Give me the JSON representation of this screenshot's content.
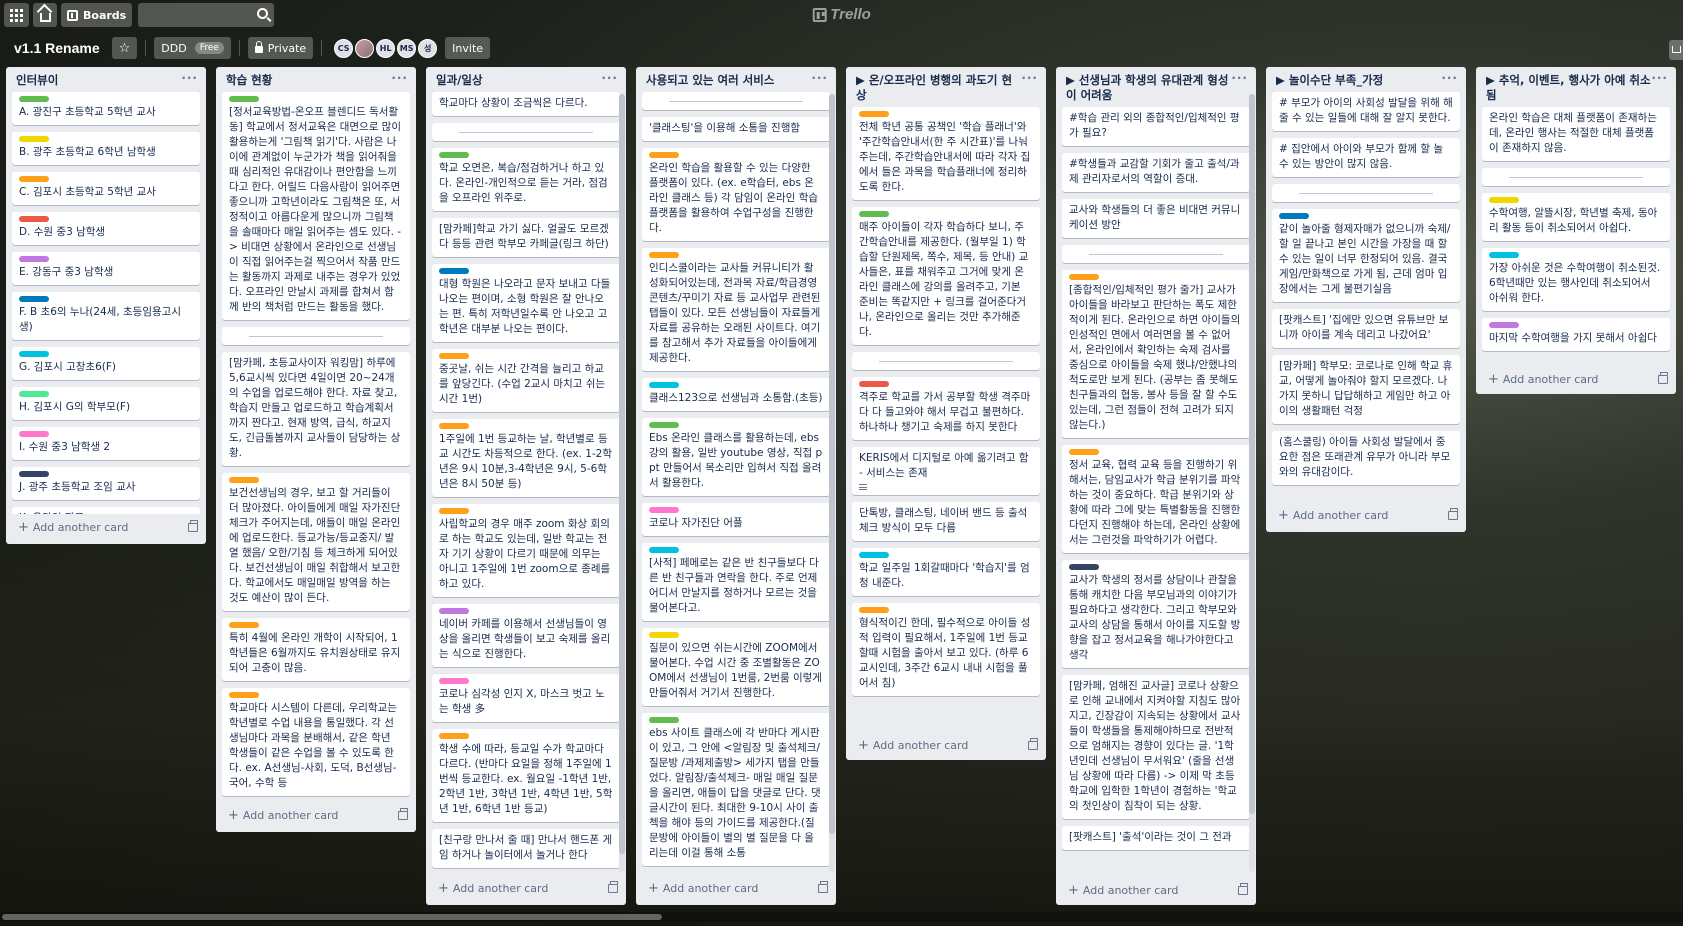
{
  "topbar": {
    "boards_label": "Boards",
    "logo": "Trello",
    "search_value": ""
  },
  "board": {
    "title": "v1.1 Rename",
    "team": "DDD",
    "plan": "Free",
    "visibility": "Private",
    "invite_label": "Invite",
    "members": [
      "CS",
      "",
      "HL",
      "MS",
      "성"
    ]
  },
  "add_card_label": "Add another card",
  "lists": [
    {
      "title": "인터뷰이",
      "cards": [
        {
          "label": "green",
          "text": "A. 광진구 초등학교 5학년 교사"
        },
        {
          "label": "yellow",
          "text": "B. 광주 초등학교 6학년 남학생"
        },
        {
          "label": "orange",
          "text": "C. 김포시 초등학교 5학년 교사"
        },
        {
          "label": "red",
          "text": "D. 수원 중3 남학생"
        },
        {
          "label": "purple",
          "text": "E. 강동구 중3 남학생"
        },
        {
          "label": "blue",
          "text": "F. B 초6의 누나(24세, 초등임용고시생)"
        },
        {
          "label": "sky",
          "text": "G. 김포시 고창초6(F)"
        },
        {
          "label": "lime",
          "text": "H. 김포시 G의 학부모(F)"
        },
        {
          "label": "pink",
          "text": "I. 수원 중3 남학생 2"
        },
        {
          "label": "black",
          "text": "J. 광주 초등학교 조임 교사"
        },
        {
          "label": "",
          "text": "K. 온라인 자료"
        }
      ]
    },
    {
      "title": "학습 현황",
      "cards": [
        {
          "label": "green",
          "text": "[정서교육방법-온오프 블렌디드 독서활동] 학교에서 정서교육은 대면으로 많이 활용하는게 '그림책 읽기'다. 사람은 나이에 관계없이 누군가가 책을 읽어줘을 때 심리적인 유대감이나 편안함을 느끼다고 한다. 어릴드 다음사람이 읽어주면 좋으니까 고학년이라도 그림책은 또, 서정적이고 아름다운게 많으니까 그림책을 솔때마다 매일 읽어주는 셈도 있다. -> 비대면 상황에서 온라인으로 선생님이 직접 읽어주는걸 찍으어서 작품 만드는 활동까지 과제로 내주는 경우가 있었다. 오프라인 만날시 과제를 합쳐서 함께 반의 책처럼 만드는 활동을 했다."
        },
        {
          "label": "",
          "divider": true,
          "text": ""
        },
        {
          "label": "",
          "text": "[맘카페, 초등교사이자 워킹맘] 하루에 5,6교시씩 있다면 4일이면 20~24개의 수업을 업로드해야 한다. 자료 찾고, 학습지 만들고 업로드하고 학습계획서까지 짠다고. 현재 방역, 급식, 하교지도, 긴급돌봄까지 교사들이 담당하는 상황."
        },
        {
          "label": "orange",
          "text": "보건선생님의 경우, 보고 할 거리들이 더 많아졌다. 아이들에게 매일 자가진단체크가 주어지는데, 애들이 매일 온라인에 업로드한다. 등교가능/등교중지/ 발열 했음/ 오한/기침 등 체크하게 되어있다. 보건선생님이 매일 취합해서 보고한다. 학교에서도 매일매일 방역을 하는 것도 예산이 많이 든다."
        },
        {
          "label": "orange",
          "text": "특히 4월에 온라인 개학이 시작되어, 1학년들은 6월까지도 유치원상태로 유지되어 고충이 많음."
        },
        {
          "label": "orange",
          "text": "학교마다 시스템이 다른데, 우리학교는 학년별로 수업 내용을 통일했다. 각 선생님마다 과목을 분배해서, 같은 학년 학생들이 같은 수업을 볼 수 있도록 한다. ex. A선생님-사회, 도덕, B선생님-국어, 수학 등"
        }
      ]
    },
    {
      "title": "일과/일상",
      "cards": [
        {
          "label": "",
          "text": "학교마다 상황이 조금씩은 다르다."
        },
        {
          "label": "",
          "divider": true,
          "text": ""
        },
        {
          "label": "green",
          "text": "학교 오면은, 복습/점검하거나 하고 있다. 온라인-개인적으로 듣는 거라, 점검을 오프라인 위주로."
        },
        {
          "label": "",
          "text": "[맘카페]학교 가기 싫다. 얼굴도 모르겠다 등등 관련 학부모 카페글(링크 하단)"
        },
        {
          "label": "blue",
          "text": "대형 학원은 나오라고 문자 보내고 다들 나오는 편이며, 소형 학원은 잘 안나오는 편. 특히 저학년일수록 안 나오고 고학년은 대부분 나오는 편이다."
        },
        {
          "label": "orange",
          "text": "중곳날, 쉬는 시간 간격을 늘리고 하교를 앞당긴다. (수업 2교시 마치고 쉬는시간 1번)"
        },
        {
          "label": "orange",
          "text": "1주일에 1번 등교하는 날, 학년별로 등교 시간도 차등적으로 한다. (ex. 1-2학년은 9시 10분,3-4학년은 9시, 5-6학년은 8시 50분 등)"
        },
        {
          "label": "orange",
          "text": "사립학교의 경우 매주 zoom 화상 회의로 하는 학교도 있는데, 일반 학교는 전자 기기 상황이 다르기 때문에 의무는 아니고 1주일에 1번 zoom으로 종례를 하고 있다."
        },
        {
          "label": "purple",
          "text": "네이버 카페를 이용해서 선생님들이 영상을 올리면 학생들이 보고 숙제를 올리는 식으로 진행한다."
        },
        {
          "label": "pink",
          "text": "코로나 심각성 인지 X, 마스크 벗고 노는 학생 多"
        },
        {
          "label": "orange",
          "text": "학생 수에 따라, 등교일 수가 학교마다 다르다. (반마다 요일을 정해 1주일에 1번씩 등교한다. ex. 월요일 -1학년 1반, 2학년 1반, 3학년 1반, 4학년 1반, 5학년 1반, 6학년 1반 등교)"
        },
        {
          "label": "",
          "text": "[친구랑 만나서 줄 때] 만나서 핸드폰 게임 하거나 놀이터에서 놀거나 한다"
        }
      ]
    },
    {
      "title": "사용되고 있는 여러 서비스",
      "cards": [
        {
          "label": "",
          "divider": true,
          "text": ""
        },
        {
          "label": "",
          "text": "'클래스팅'을 이용해 소통을 진행함"
        },
        {
          "label": "orange",
          "text": "온라인 학습을 활용할 수 있는 다양한 플랫폼이 있다. (ex. e학습터, ebs 온라인 클래스 등) 각 담임이 온라인 학습 플랫폼을 활용하여 수업구성을 진행한다."
        },
        {
          "label": "orange",
          "text": "인디스쿨이라는 교사들 커뮤니티가 활성화되어있는데, 전과목 자료/학급경영 콘텐츠/꾸미기 자료 등 교사업무 관련된 탭들이 있다. 모든 선생님들이 자료들게 자료를 공유하는 오래된 사이트다. 여기를 참고해서 추가 자료들을 아이들에게 제공한다."
        },
        {
          "label": "sky",
          "text": "클래스123으로 선생님과 소통함.(초등)"
        },
        {
          "label": "green",
          "text": "Ebs 온라인 클래스를 활용하는데, ebs 강의 활용, 일반 youtube 영상, 직접 ppt 만들어서 목소리만 입혀서 직접 올려서 활용한다."
        },
        {
          "label": "pink",
          "text": "코로나 자가진단 어플"
        },
        {
          "label": "sky",
          "text": "[사적] 페메로는 같은 반 친구들보다 다른 반 친구들과 연락을 한다. 주로 언제 어디서 만날지를 정하거나 모르는 것을 물어본다고."
        },
        {
          "label": "yellow",
          "text": "질문이 있으면 쉬는시간에 ZOOM에서 물어본다. 수업 시간 중 조별활동은 ZOOM에서 선생님이 1번룸, 2번룸 이렇게 만들어줘서 거기서 진행한다."
        },
        {
          "label": "green",
          "text": "ebs 사이트 클래스에 각 반마다 게시판이 있고, 그 안에 <알림장 및 출석체크/질문방 /과제제출방> 세가지 탭을 만들었다. 알림장/출석체크- 매일 매일 질문을 올리면, 애들이 답을 댓글로 단다. 댓글시간이 된다. 최대한 9-10시 사이 출첵을 해야 등의 가이드를 제공한다.(질문방에 아이들이 별의 별 질문을 다 올리는데 이걸 통해 소통"
        }
      ]
    },
    {
      "title": "▶ 온/오프라인 병행의 과도기 현상",
      "cards": [
        {
          "label": "orange",
          "text": "전체 학년 공통 공책인 '학습 플래너'와 '주간학습안내서(한 주 시간표)'를 나눠주는데, 주간학습안내서에 따라 각자 집에서 들은 과목을 학습플래너에 정리하도록 한다."
        },
        {
          "label": "green",
          "text": "매주 아이들이 각자 학습하다 보니, 주간학습안내를 제공한다. (월부일 1) 학습할 단원제목, 쪽수, 제목, 등 안내) 교사들은, 표를 채워주고 그거에 맞게 온라인 클래스에 강의를 올려주고, 기본 준비는 똑같지만 + 링크를 걸어준다거나, 온라인으로 올리는 것만 추가해준다."
        },
        {
          "label": "",
          "divider": true,
          "text": ""
        },
        {
          "label": "red",
          "text": "격주로 학교를 가서 공부할 학생 격주마다 다 들고와야 해서 무겁고 불편하다. 하나하나 챙기고 숙제를 하지 못한다"
        },
        {
          "label": "",
          "text": "KERIS에서 디지털로 아예 옮기려고 함 - 서비스는 존재",
          "desc": true
        },
        {
          "label": "",
          "text": "단톡방, 클래스팅, 네이버 밴드 등 출석체크 방식이 모두 다름"
        },
        {
          "label": "sky",
          "text": "학교 일주일 1회갈때마다 '학습지'를 엄청 내준다."
        },
        {
          "label": "orange",
          "text": "형식적이긴 한데, 필수적으로 아이들 성적 입력이 필요해서, 1주일에 1번 등교할때 시험을 출아서 보고 있다. (하루 6교시인데, 3주간 6교시 내내 시험을 풀어서 침)"
        }
      ]
    },
    {
      "title": "▶ 선생님과 학생의 유대관계 형성이 어려움",
      "cards": [
        {
          "label": "",
          "text": "#학습 관리 외의 종합적인/입체적인 평가 필요?"
        },
        {
          "label": "",
          "text": "#학생들과 교감할 기회가 줄고 출석/과제 관리자로서의 역할이 증대."
        },
        {
          "label": "",
          "text": "교사와 학생들의 더 좋은 비대면 커뮤니케이션 방안"
        },
        {
          "label": "",
          "divider": true,
          "text": ""
        },
        {
          "label": "orange",
          "text": "[종합적인/입체적인 평가 줄가] 교사가 아이들을 바라보고 판단하는 폭도 제한적이게 된다. 온라인으로 하면 아이들의 인성적인 면에서 여러면을 볼 수 없어서, 온라인에서 확인하는 숙제 검사를 중심으로 아이들을 숙제 했냐/안했냐의 척도로만 보게 된다. (공부는 좀 못해도 친구들과의 협동, 봉사 등을 잘 할 수도 있는데, 그런 점들이 전혀 고려가 되지 않는다.)"
        },
        {
          "label": "orange",
          "text": "정서 교육, 협력 교육 등을 진행하기 위해서는, 담임교사가 학급 분위기를 파악하는 것이 중요하다. 학급 분위기와 상황에 따라 그에 맞는 특별활동을 진행한다던지 진행해야 하는데, 온라인 상황에서는 그런것을 파악하기가 어렵다."
        },
        {
          "label": "black",
          "text": "교사가 학생의 정서를 상담이나 관찰을 통해 캐치한 다음 부모님과의 이야기가 필요하다고 생각한다. 그리고 학부모와 교사의 상담을 통해서 아이를 지도할 방향을 잡고 정서교육을 해나가야한다고 생각"
        },
        {
          "label": "",
          "text": "[맘카페, 엄해진 교사글] 코로나 상황으로 인해 교내에서 지켜야할 지침도 많아지고, 긴장감이 지속되는 상황에서 교사들이 학생들을 통제해야하므로 전반적으로 엄해지는 경향이 있다는 글. '1학년인데 선생님이 무서워요' (줄을 선생님 상황에 따라 다름) -> 이제 막 초등학교에 입학한 1학년이 경험하는 '학교의 첫인상이 침착이 되는 상황."
        },
        {
          "label": "",
          "text": "[팟캐스트] '출석'이라는 것이 그 전과"
        }
      ]
    },
    {
      "title": "▶ 놀이수단 부족_가정",
      "cards": [
        {
          "label": "",
          "text": "# 부모가 아이의 사회성 발달을 위해 해줄 수 있는 일들에 대해 잘 알지 못한다."
        },
        {
          "label": "",
          "text": "# 집안에서 아이와 부모가 함께 할 놀 수 있는 방안이 많지 않음."
        },
        {
          "label": "",
          "divider": true,
          "text": ""
        },
        {
          "label": "blue",
          "text": "같이 놀아줄 형제자매가 없으니까 숙제/할 일 끝나고 본인 시간을 가장을 때 할 수 있는 일이 너무 한정되어 있음. 결국 게임/만화책으로 가게 됨, 근데 엄마 입장에서는 그게 불편기실음"
        },
        {
          "label": "",
          "text": "[팟캐스트] '집에만 있으면 유튜브만 보니까 아이를 계속 데리고 나갔어요'"
        },
        {
          "label": "",
          "text": "[맘카페] 학부모: 코로나로 인해 학교 휴교, 어떻게 놀아줘야 할지 모르겠다. 나가지 못하니 답답해하고 게임만 하고 아이의 생활패턴 걱정"
        },
        {
          "label": "",
          "text": "(홈스쿨링) 아이들 사회성 발달에서 중요한 점은 또래관계 유무가 아니라 부모와의 유대감이다."
        }
      ]
    },
    {
      "title": "▶ 추억, 이벤트, 행사가 아예 취소됨",
      "cards": [
        {
          "label": "",
          "text": "온라인 학습은 대체 플랫폼이 존재하는데, 온라인 행사는 적절한 대체 플랫폼이 존재하지 않음."
        },
        {
          "label": "",
          "divider": true,
          "text": ""
        },
        {
          "label": "yellow",
          "text": "수학여행, 알뜰시장, 학년별 축제, 동아리 활동 등이 취소되어서 아쉽다."
        },
        {
          "label": "sky",
          "text": "가장 아쉬운 것은 수학여행이 취소된것. 6학년때만 있는 행사인데 취소되어서 아쉬워 한다."
        },
        {
          "label": "purple",
          "text": "마지막 수학여행을 가지 못해서 아쉽다"
        }
      ]
    }
  ]
}
